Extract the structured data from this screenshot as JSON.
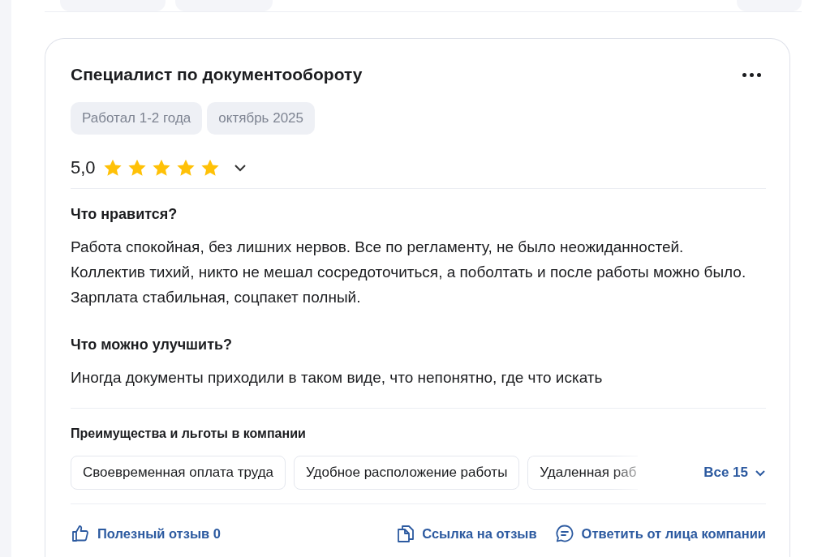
{
  "review": {
    "title": "Специалист по документообороту",
    "tags": [
      "Работал 1-2 года",
      "октябрь 2025"
    ],
    "rating": {
      "value": "5,0",
      "stars": 5
    },
    "sections": [
      {
        "heading": "Что нравится?",
        "text": "Работа спокойная, без лишних нервов. Все по регламенту, не было неожиданностей. Коллектив тихий, никто не мешал сосредоточиться, а поболтать и после работы можно было. Зарплата стабильная, соцпакет полный."
      },
      {
        "heading": "Что можно улучшить?",
        "text": "Иногда документы приходили в таком виде, что непонятно, где что искать"
      }
    ],
    "benefits": {
      "heading": "Преимущества и льготы в компании",
      "items": [
        "Своевременная оплата труда",
        "Удобное расположение работы",
        "Удаленная раб"
      ],
      "more": "Все 15"
    },
    "actions": [
      {
        "kind": "like",
        "label": "Полезный отзыв 0"
      },
      {
        "kind": "copy",
        "label": "Ссылка на отзыв"
      },
      {
        "kind": "comment",
        "label": "Ответить от лица компании"
      }
    ]
  }
}
